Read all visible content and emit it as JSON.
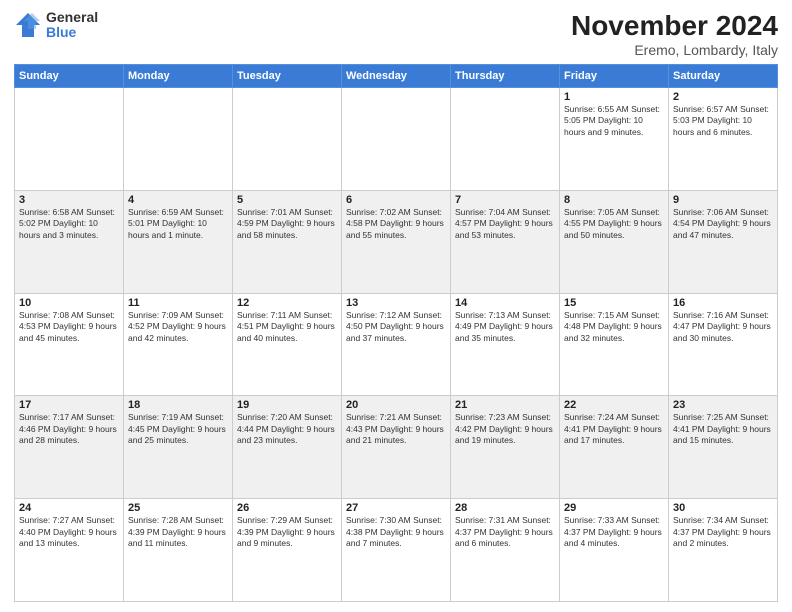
{
  "header": {
    "logo_general": "General",
    "logo_blue": "Blue",
    "title": "November 2024",
    "subtitle": "Eremo, Lombardy, Italy"
  },
  "weekdays": [
    "Sunday",
    "Monday",
    "Tuesday",
    "Wednesday",
    "Thursday",
    "Friday",
    "Saturday"
  ],
  "rows": [
    [
      {
        "day": "",
        "info": ""
      },
      {
        "day": "",
        "info": ""
      },
      {
        "day": "",
        "info": ""
      },
      {
        "day": "",
        "info": ""
      },
      {
        "day": "",
        "info": ""
      },
      {
        "day": "1",
        "info": "Sunrise: 6:55 AM\nSunset: 5:05 PM\nDaylight: 10 hours and 9 minutes."
      },
      {
        "day": "2",
        "info": "Sunrise: 6:57 AM\nSunset: 5:03 PM\nDaylight: 10 hours and 6 minutes."
      }
    ],
    [
      {
        "day": "3",
        "info": "Sunrise: 6:58 AM\nSunset: 5:02 PM\nDaylight: 10 hours and 3 minutes."
      },
      {
        "day": "4",
        "info": "Sunrise: 6:59 AM\nSunset: 5:01 PM\nDaylight: 10 hours and 1 minute."
      },
      {
        "day": "5",
        "info": "Sunrise: 7:01 AM\nSunset: 4:59 PM\nDaylight: 9 hours and 58 minutes."
      },
      {
        "day": "6",
        "info": "Sunrise: 7:02 AM\nSunset: 4:58 PM\nDaylight: 9 hours and 55 minutes."
      },
      {
        "day": "7",
        "info": "Sunrise: 7:04 AM\nSunset: 4:57 PM\nDaylight: 9 hours and 53 minutes."
      },
      {
        "day": "8",
        "info": "Sunrise: 7:05 AM\nSunset: 4:55 PM\nDaylight: 9 hours and 50 minutes."
      },
      {
        "day": "9",
        "info": "Sunrise: 7:06 AM\nSunset: 4:54 PM\nDaylight: 9 hours and 47 minutes."
      }
    ],
    [
      {
        "day": "10",
        "info": "Sunrise: 7:08 AM\nSunset: 4:53 PM\nDaylight: 9 hours and 45 minutes."
      },
      {
        "day": "11",
        "info": "Sunrise: 7:09 AM\nSunset: 4:52 PM\nDaylight: 9 hours and 42 minutes."
      },
      {
        "day": "12",
        "info": "Sunrise: 7:11 AM\nSunset: 4:51 PM\nDaylight: 9 hours and 40 minutes."
      },
      {
        "day": "13",
        "info": "Sunrise: 7:12 AM\nSunset: 4:50 PM\nDaylight: 9 hours and 37 minutes."
      },
      {
        "day": "14",
        "info": "Sunrise: 7:13 AM\nSunset: 4:49 PM\nDaylight: 9 hours and 35 minutes."
      },
      {
        "day": "15",
        "info": "Sunrise: 7:15 AM\nSunset: 4:48 PM\nDaylight: 9 hours and 32 minutes."
      },
      {
        "day": "16",
        "info": "Sunrise: 7:16 AM\nSunset: 4:47 PM\nDaylight: 9 hours and 30 minutes."
      }
    ],
    [
      {
        "day": "17",
        "info": "Sunrise: 7:17 AM\nSunset: 4:46 PM\nDaylight: 9 hours and 28 minutes."
      },
      {
        "day": "18",
        "info": "Sunrise: 7:19 AM\nSunset: 4:45 PM\nDaylight: 9 hours and 25 minutes."
      },
      {
        "day": "19",
        "info": "Sunrise: 7:20 AM\nSunset: 4:44 PM\nDaylight: 9 hours and 23 minutes."
      },
      {
        "day": "20",
        "info": "Sunrise: 7:21 AM\nSunset: 4:43 PM\nDaylight: 9 hours and 21 minutes."
      },
      {
        "day": "21",
        "info": "Sunrise: 7:23 AM\nSunset: 4:42 PM\nDaylight: 9 hours and 19 minutes."
      },
      {
        "day": "22",
        "info": "Sunrise: 7:24 AM\nSunset: 4:41 PM\nDaylight: 9 hours and 17 minutes."
      },
      {
        "day": "23",
        "info": "Sunrise: 7:25 AM\nSunset: 4:41 PM\nDaylight: 9 hours and 15 minutes."
      }
    ],
    [
      {
        "day": "24",
        "info": "Sunrise: 7:27 AM\nSunset: 4:40 PM\nDaylight: 9 hours and 13 minutes."
      },
      {
        "day": "25",
        "info": "Sunrise: 7:28 AM\nSunset: 4:39 PM\nDaylight: 9 hours and 11 minutes."
      },
      {
        "day": "26",
        "info": "Sunrise: 7:29 AM\nSunset: 4:39 PM\nDaylight: 9 hours and 9 minutes."
      },
      {
        "day": "27",
        "info": "Sunrise: 7:30 AM\nSunset: 4:38 PM\nDaylight: 9 hours and 7 minutes."
      },
      {
        "day": "28",
        "info": "Sunrise: 7:31 AM\nSunset: 4:37 PM\nDaylight: 9 hours and 6 minutes."
      },
      {
        "day": "29",
        "info": "Sunrise: 7:33 AM\nSunset: 4:37 PM\nDaylight: 9 hours and 4 minutes."
      },
      {
        "day": "30",
        "info": "Sunrise: 7:34 AM\nSunset: 4:37 PM\nDaylight: 9 hours and 2 minutes."
      }
    ]
  ]
}
